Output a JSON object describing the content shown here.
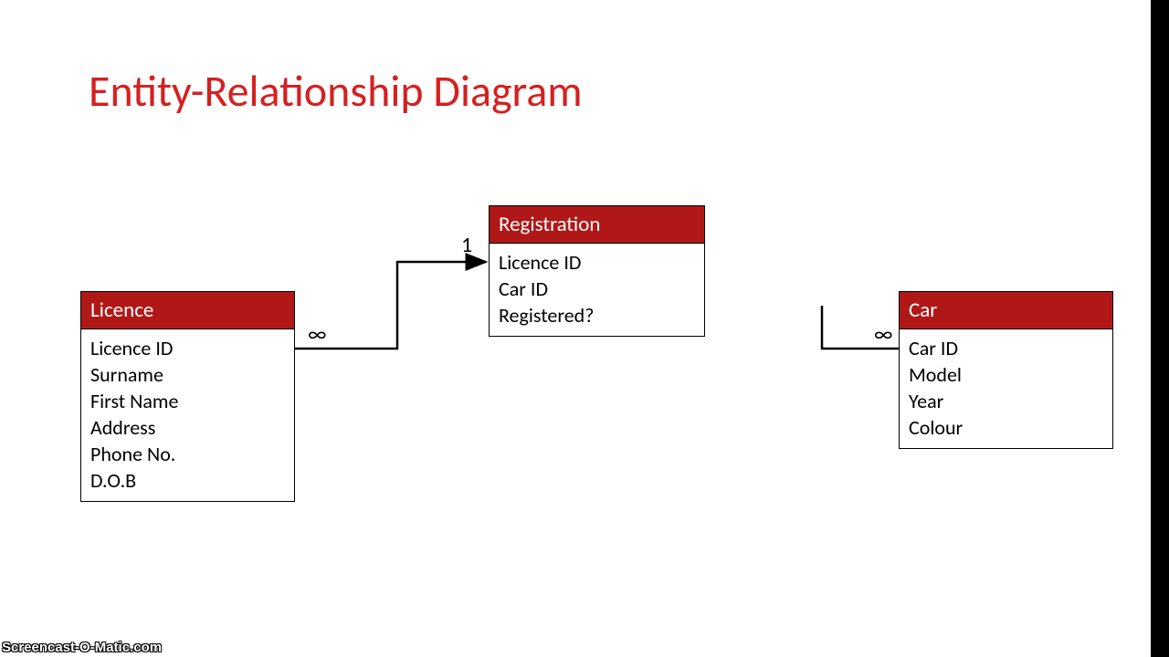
{
  "title": "Entity-Relationship Diagram",
  "entities": {
    "licence": {
      "name": "Licence",
      "attr0": "Licence ID",
      "attr1": "Surname",
      "attr2": "First Name",
      "attr3": "Address",
      "attr4": "Phone No.",
      "attr5": "D.O.B"
    },
    "registration": {
      "name": "Registration",
      "attr0": "Licence ID",
      "attr1": "Car ID",
      "attr2": "Registered?"
    },
    "car": {
      "name": "Car",
      "attr0": "Car ID",
      "attr1": "Model",
      "attr2": "Year",
      "attr3": "Colour"
    }
  },
  "connectors": {
    "licence_to_reg_left": "∞",
    "licence_to_reg_right": "1",
    "car_to_reg_right": "∞"
  },
  "watermark": "Screencast-O-Matic.com"
}
